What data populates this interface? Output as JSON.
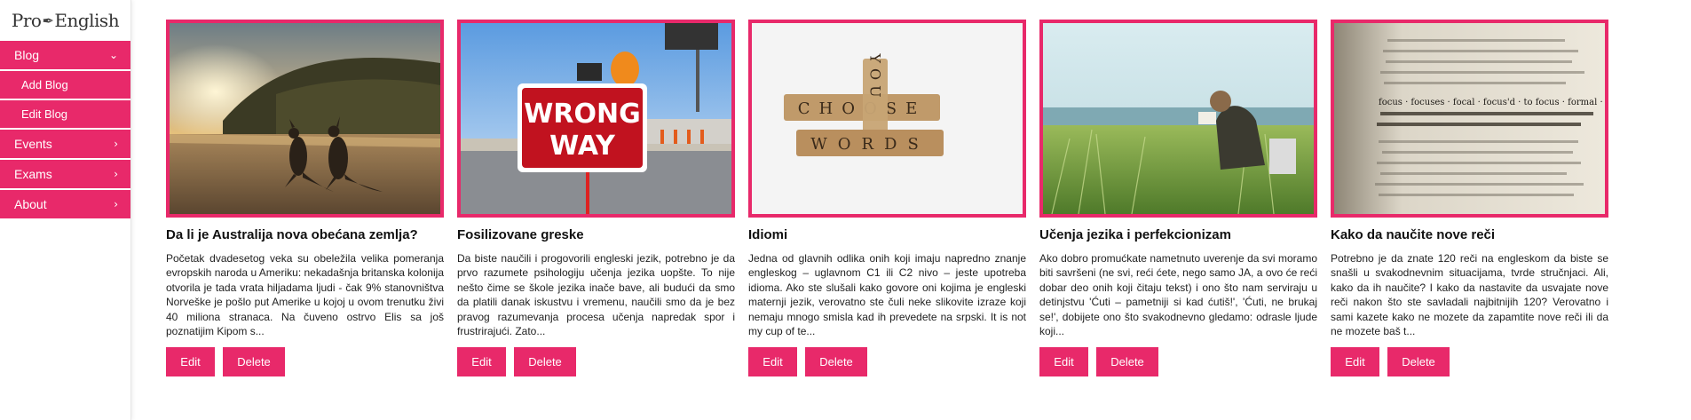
{
  "app": {
    "logo_left": "Pro",
    "logo_right": "English"
  },
  "sidebar": {
    "items": [
      {
        "label": "Blog",
        "chevron": "chevron-down"
      },
      {
        "label": "Add Blog"
      },
      {
        "label": "Edit Blog"
      },
      {
        "label": "Events",
        "chevron": "chevron-right"
      },
      {
        "label": "Exams",
        "chevron": "chevron-right"
      },
      {
        "label": "About",
        "chevron": "chevron-right"
      }
    ]
  },
  "cards": [
    {
      "title": "Da li je Australija nova obećana zemlja?",
      "excerpt": "Početak dvadesetog veka su obeležila velika pomeranja evropskih naroda u Ameriku: nekadašnja britanska kolonija otvorila je tada vrata hiljadama ljudi - čak 9% stanovništva Norveške je pošlo put Amerike u kojoj u ovom trenutku živi 40 miliona stranaca. Na čuveno ostrvo Elis sa još poznatijim Kipom s...",
      "edit_label": "Edit",
      "delete_label": "Delete",
      "image": "kangaroos-on-beach-at-sunset"
    },
    {
      "title": "Fosilizovane greske",
      "excerpt": "Da biste naučili i progovorili engleski jezik, potrebno je da prvo razumete psihologiju učenja jezika uopšte. To nije nešto čime se škole jezika inače bave, ali budući da smo da platili danak iskustvu i vremenu, naučili smo da je bez pravog razumevanja procesa učenja napredak spor i frustrirajući. Zato...",
      "edit_label": "Edit",
      "delete_label": "Delete",
      "image": "wrong-way-sign"
    },
    {
      "title": "Idiomi",
      "excerpt": "Jedna od glavnih odlika onih koji imaju napredno znanje engleskog – uglavnom C1 ili C2 nivo – jeste upotreba idioma. Ako ste slušali kako govore oni kojima je engleski maternji jezik, verovatno ste čuli neke slikovite izraze koji nemaju mnogo smisla kad ih prevedete na srpski. It is not my cup of te...",
      "edit_label": "Edit",
      "delete_label": "Delete",
      "image": "scrabble-choose-your-words"
    },
    {
      "title": "Učenja jezika i perfekcionizam",
      "excerpt": "Ako dobro promućkate nametnuto uverenje da svi moramo biti savršeni (ne svi, reći ćete, nego samo JA, a ovo će reći dobar deo onih koji čitaju tekst) i ono što nam serviraju u detinjstvu 'Ćuti – pametniji si kad ćutiš!', 'Ćuti, ne brukaj se!', dobijete ono što svakodnevno gledamo: odrasle ljude koji...",
      "edit_label": "Edit",
      "delete_label": "Delete",
      "image": "man-reading-in-grass"
    },
    {
      "title": "Kako da naučite nove reči",
      "excerpt": "Potrebno je da znate 120 reči na engleskom da biste se snašli u svakodnevnim situacijama, tvrde stručnjaci. Ali, kako da ih naučite? I kako da nastavite da usvajate nove reči nakon što ste savladali najbitnijih 120? Verovatno i sami kazete kako ne mozete da zapamtite nove reči ili da ne mozete baš t...",
      "edit_label": "Edit",
      "delete_label": "Delete",
      "image": "dictionary-page-closeup"
    }
  ],
  "image_text": {
    "sign_line1": "WRONG",
    "sign_line2": "WAY",
    "tiles_row1": "CHOOSE",
    "tiles_col": "YOU",
    "tiles_row2": "WORDS",
    "dict_words": "focus · focuses · focal · focus'd · to focus · formal · foci"
  },
  "colors": {
    "accent": "#e8296a"
  }
}
